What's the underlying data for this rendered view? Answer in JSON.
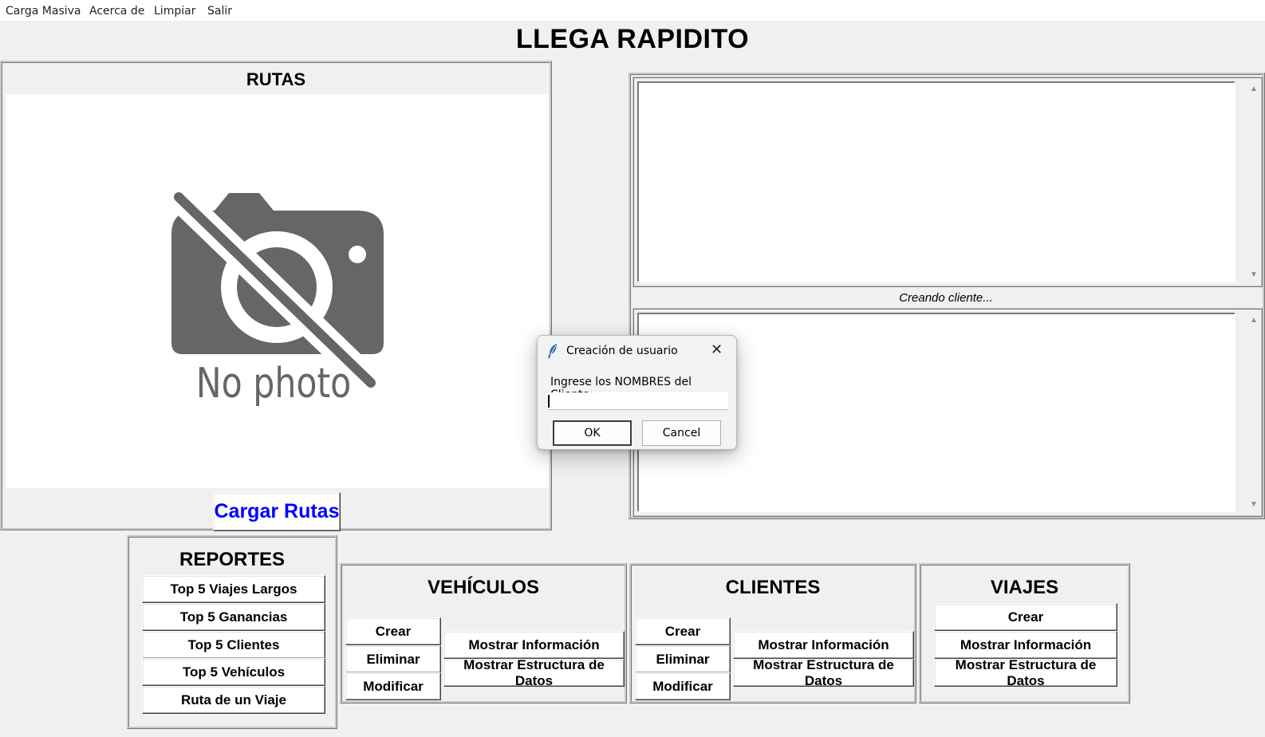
{
  "menu": [
    "Carga Masiva",
    "Acerca de",
    "Limpiar",
    "Salir"
  ],
  "app_title": "LLEGA RAPIDITO",
  "rutas": {
    "title": "RUTAS",
    "placeholder_text": "No photo",
    "load_button": "Cargar Rutas",
    "load_button_color": "#0000ff"
  },
  "console": {
    "status": "Creando cliente..."
  },
  "reportes": {
    "title": "REPORTES",
    "buttons": [
      "Top 5 Viajes Largos",
      "Top 5 Ganancias",
      "Top 5 Clientes",
      "Top 5 Vehículos",
      "Ruta de un Viaje"
    ]
  },
  "vehiculos": {
    "title": "VEHÍCULOS",
    "crear": "Crear",
    "eliminar": "Eliminar",
    "modificar": "Modificar",
    "mostrar_info": "Mostrar Información",
    "mostrar_estructura": "Mostrar Estructura de Datos"
  },
  "clientes": {
    "title": "CLIENTES",
    "crear": "Crear",
    "eliminar": "Eliminar",
    "modificar": "Modificar",
    "mostrar_info": "Mostrar Información",
    "mostrar_estructura": "Mostrar Estructura de Datos"
  },
  "viajes": {
    "title": "VIAJES",
    "crear": "Crear",
    "mostrar_info": "Mostrar Información",
    "mostrar_estructura": "Mostrar Estructura de Datos"
  },
  "dialog": {
    "title": "Creación de usuario",
    "prompt": "Ingrese los NOMBRES del Cliente:",
    "input_value": "",
    "ok": "OK",
    "cancel": "Cancel"
  }
}
